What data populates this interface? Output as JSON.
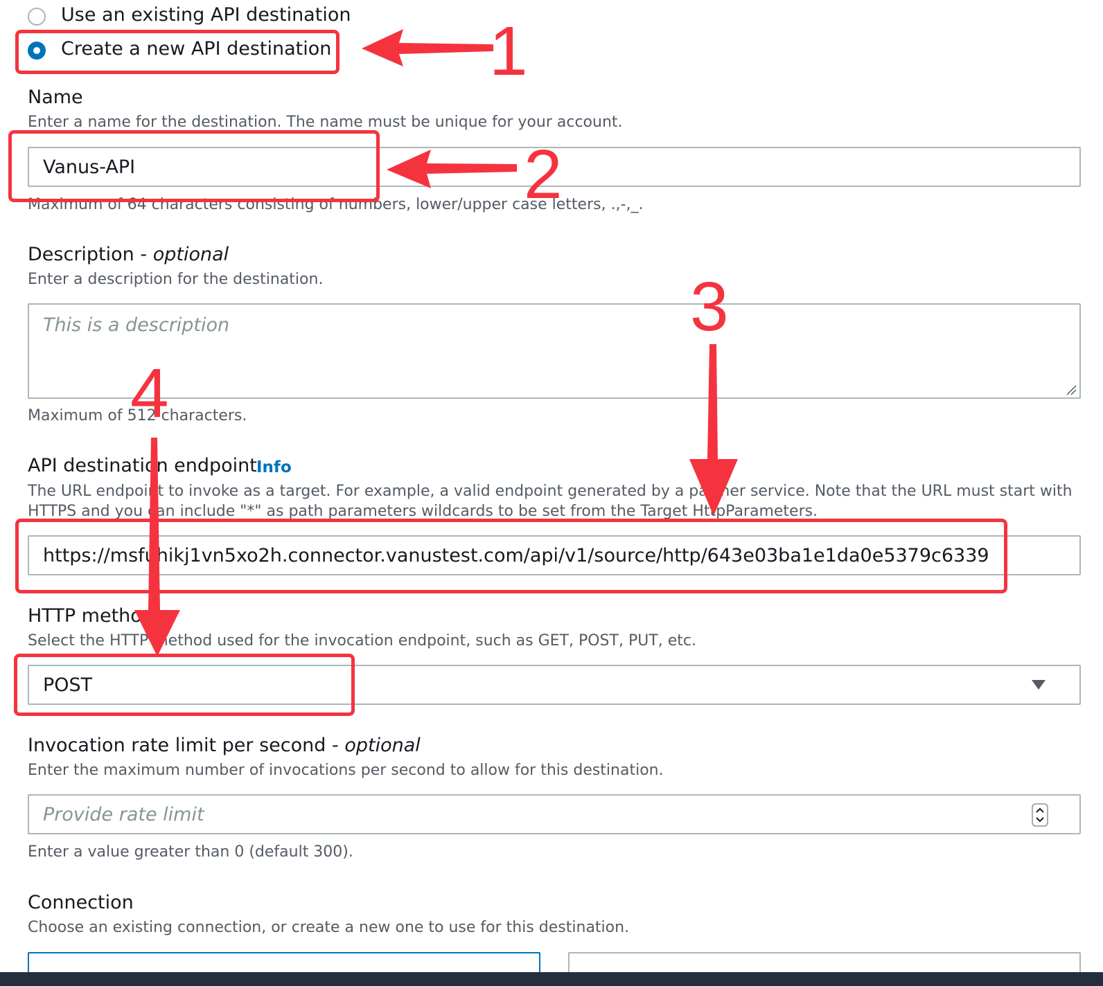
{
  "radio_options": [
    {
      "label": "Use an existing API destination",
      "selected": false
    },
    {
      "label": "Create a new API destination",
      "selected": true
    }
  ],
  "name_field": {
    "label": "Name",
    "description": "Enter a name for the destination. The name must be unique for your account.",
    "value": "Vanus-API",
    "hint": "Maximum of 64 characters consisting of numbers, lower/upper case letters, .,-,_."
  },
  "description_field": {
    "label": "Description",
    "optional": "optional",
    "description": "Enter a description for the destination.",
    "placeholder": "This is a description",
    "hint": "Maximum of 512 characters."
  },
  "endpoint_field": {
    "label": "API destination endpoint",
    "info": "Info",
    "description_line1": "The URL endpoint to invoke as a target. For example, a valid endpoint generated by a partner service. Note that the URL must start with",
    "description_line2": "HTTPS and you can include \"*\" as path parameters wildcards to be set from the Target HttpParameters.",
    "value": "https://msfuhikj1vn5xo2h.connector.vanustest.com/api/v1/source/http/643e03ba1e1da0e5379c6339"
  },
  "method_field": {
    "label": "HTTP method",
    "description": "Select the HTTP method used for the invocation endpoint, such as GET, POST, PUT, etc.",
    "value": "POST"
  },
  "rate_field": {
    "label": "Invocation rate limit per second",
    "optional": "optional",
    "description": "Enter the maximum number of invocations per second to allow for this destination.",
    "placeholder": "Provide rate limit",
    "hint": "Enter a value greater than 0 (default 300)."
  },
  "connection_field": {
    "label": "Connection",
    "description": "Choose an existing connection, or create a new one to use for this destination."
  },
  "annotations": [
    "1",
    "2",
    "3",
    "4"
  ],
  "colors": {
    "annotation": "#f5333f",
    "accent": "#0073bb"
  }
}
